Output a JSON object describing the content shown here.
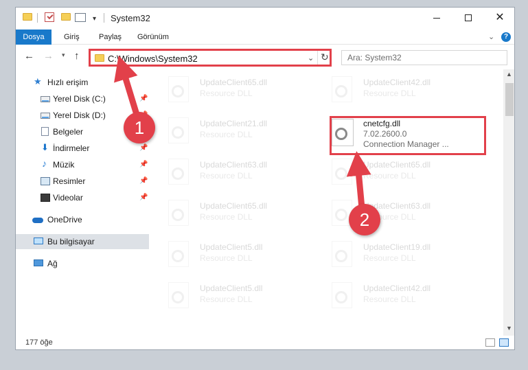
{
  "window": {
    "title": "System32"
  },
  "ribbon": {
    "tabs": [
      {
        "label": "Dosya"
      },
      {
        "label": "Giriş"
      },
      {
        "label": "Paylaş"
      },
      {
        "label": "Görünüm"
      }
    ],
    "help": "?"
  },
  "addressbar": {
    "path": "C:\\Windows\\System32",
    "search_placeholder": "Ara: System32"
  },
  "navpane": {
    "items": [
      {
        "label": "Hızlı erişim",
        "icon": "star-icon"
      },
      {
        "label": "Yerel Disk (C:)",
        "icon": "drive-icon",
        "pinned": true
      },
      {
        "label": "Yerel Disk (D:)",
        "icon": "drive-icon",
        "pinned": true
      },
      {
        "label": "Belgeler",
        "icon": "documents-icon",
        "pinned": true
      },
      {
        "label": "İndirmeler",
        "icon": "download-icon",
        "pinned": true
      },
      {
        "label": "Müzik",
        "icon": "music-icon",
        "pinned": true
      },
      {
        "label": "Resimler",
        "icon": "pictures-icon",
        "pinned": true
      },
      {
        "label": "Videolar",
        "icon": "videos-icon",
        "pinned": true
      },
      {
        "label": "OneDrive",
        "icon": "cloud-icon"
      },
      {
        "label": "Bu bilgisayar",
        "icon": "computer-icon",
        "selected": true
      },
      {
        "label": "Ağ",
        "icon": "network-icon"
      }
    ]
  },
  "files": [
    {
      "name": "UpdateClient65.dll",
      "type": "Resource DLL"
    },
    {
      "name": "UpdateClient42.dll",
      "type": "Resource DLL"
    },
    {
      "name": "UpdateClient21.dll",
      "type": "Resource DLL"
    },
    {
      "name": "cnetcfg.dll",
      "version": "7.02.2600.0",
      "description": "Connection Manager ...",
      "highlighted": true
    },
    {
      "name": "UpdateClient63.dll",
      "type": "Resource DLL"
    },
    {
      "name": "UpdateClient65.dll",
      "type": "Resource DLL"
    },
    {
      "name": "UpdateClient65.dll",
      "type": "Resource DLL"
    },
    {
      "name": "UpdateClient63.dll",
      "type": "Resource DLL"
    },
    {
      "name": "UpdateClient5.dll",
      "type": "Resource DLL"
    },
    {
      "name": "UpdateClient19.dll",
      "type": "Resource DLL"
    },
    {
      "name": "UpdateClient5.dll",
      "type": "Resource DLL"
    },
    {
      "name": "UpdateClient42.dll",
      "type": "Resource DLL"
    }
  ],
  "statusbar": {
    "item_count": "177 öğe"
  },
  "annotations": {
    "marker1": "1",
    "marker2": "2",
    "color": "#e2404a"
  }
}
